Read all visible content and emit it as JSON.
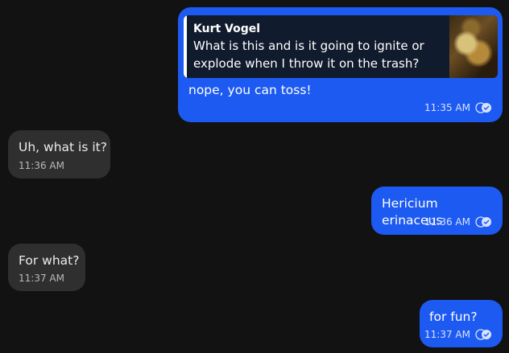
{
  "messages": [
    {
      "direction": "outgoing",
      "reply": {
        "author": "Kurt Vogel",
        "text": "What is this and is it going to ignite or\nexplode when I throw it on the trash?",
        "thumbnail": "gold-nugget-photo"
      },
      "text": "nope, you can toss!",
      "time": "11:35 AM",
      "status": "read"
    },
    {
      "direction": "incoming",
      "text": "Uh, what is it?",
      "time": "11:36 AM"
    },
    {
      "direction": "outgoing",
      "text": "Hericium erinaceus",
      "time": "11:36 AM",
      "status": "read"
    },
    {
      "direction": "incoming",
      "text": "For what?",
      "time": "11:37 AM"
    },
    {
      "direction": "outgoing",
      "text": "for fun?",
      "time": "11:37 AM",
      "status": "read"
    }
  ],
  "colors": {
    "background": "#121212",
    "outgoing_bubble": "#1d5af1",
    "incoming_bubble": "#2f2f30"
  },
  "icons": {
    "read_status": "double-check-icon"
  }
}
